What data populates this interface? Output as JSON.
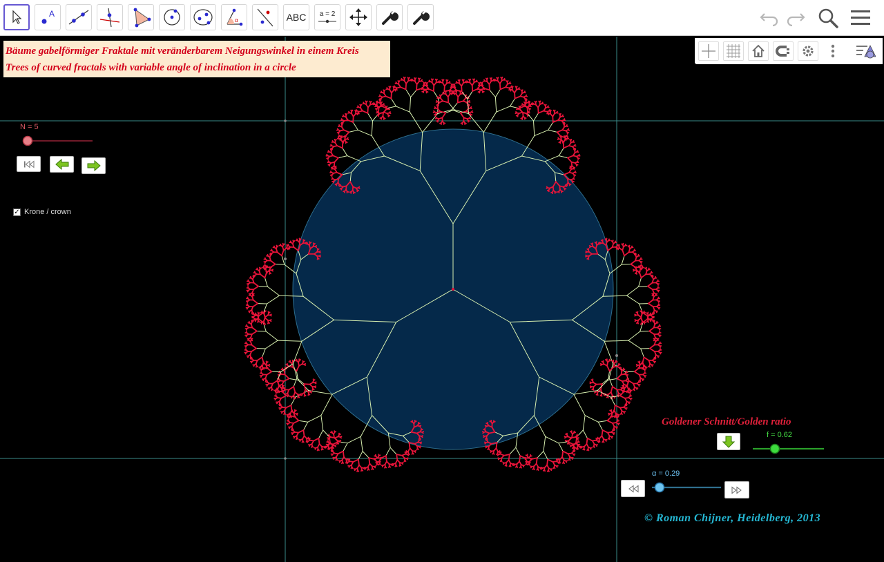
{
  "toolbar": {
    "tools": [
      {
        "name": "move-tool",
        "icon": "cursor-arrow-icon"
      },
      {
        "name": "point-tool",
        "icon": "point-icon",
        "letter": "A"
      },
      {
        "name": "line-tool",
        "icon": "line-through-points-icon"
      },
      {
        "name": "perpendicular-tool",
        "icon": "perpendicular-line-icon"
      },
      {
        "name": "polygon-tool",
        "icon": "polygon-icon"
      },
      {
        "name": "circle-tool",
        "icon": "circle-center-point-icon"
      },
      {
        "name": "conic-tool",
        "icon": "ellipse-icon"
      },
      {
        "name": "angle-tool",
        "icon": "angle-icon",
        "letter": "α"
      },
      {
        "name": "reflect-tool",
        "icon": "reflect-about-line-icon"
      },
      {
        "name": "text-tool",
        "icon": "text-icon",
        "label": "ABC"
      },
      {
        "name": "slider-tool",
        "icon": "slider-icon",
        "label": "a = 2"
      },
      {
        "name": "move-view-tool",
        "icon": "move-graphics-view-icon"
      },
      {
        "name": "custom-tool-1",
        "icon": "wrench-icon"
      },
      {
        "name": "custom-tool-2",
        "icon": "wrench-icon"
      }
    ],
    "right": [
      "undo-icon",
      "redo-icon",
      "search-icon",
      "menu-icon"
    ]
  },
  "style_bar": [
    "axes-icon",
    "grid-icon",
    "home-icon",
    "point-capturing-icon",
    "gear-icon",
    "more-vertical-icon",
    "style-bar-toggle-icon"
  ],
  "title": {
    "line1": "Bäume gabelförmiger Fraktale  mit veränderbarem Neigungswinkel in einem  Kreis",
    "line2": "Trees of  curved fractals with variable angle of inclination in a circle"
  },
  "slider_n": {
    "label": "N = 5",
    "value": 5,
    "min": 0,
    "max": 12,
    "color": "#e05a66"
  },
  "nav_buttons": [
    {
      "name": "rewind-button",
      "icon": "first-step-icon"
    },
    {
      "name": "step-back-button",
      "icon": "green-arrow-left-icon"
    },
    {
      "name": "step-forward-button",
      "icon": "green-arrow-right-icon"
    }
  ],
  "crown_checkbox": {
    "label": "Krone / crown",
    "checked": true,
    "mark": "✓"
  },
  "golden_ratio": {
    "label": "Goldener Schnitt/Golden ratio"
  },
  "slider_f": {
    "label": "f = 0.62",
    "value": 0.62,
    "min": 0,
    "max": 1,
    "color": "#22c022"
  },
  "slider_alpha": {
    "label": "α = 0.29",
    "value": 0.29,
    "min": 0,
    "max": 1.5,
    "color": "#5ab8e8"
  },
  "copyright": "© Roman Chijner, Heidelberg, 2013",
  "colors": {
    "disk": "#05294a",
    "branch": "#d8f0b0",
    "crown": "#e8143a",
    "grid_line": "#3a8c8a",
    "title_bg": "#fdebd0",
    "title_text": "#d3001a"
  }
}
